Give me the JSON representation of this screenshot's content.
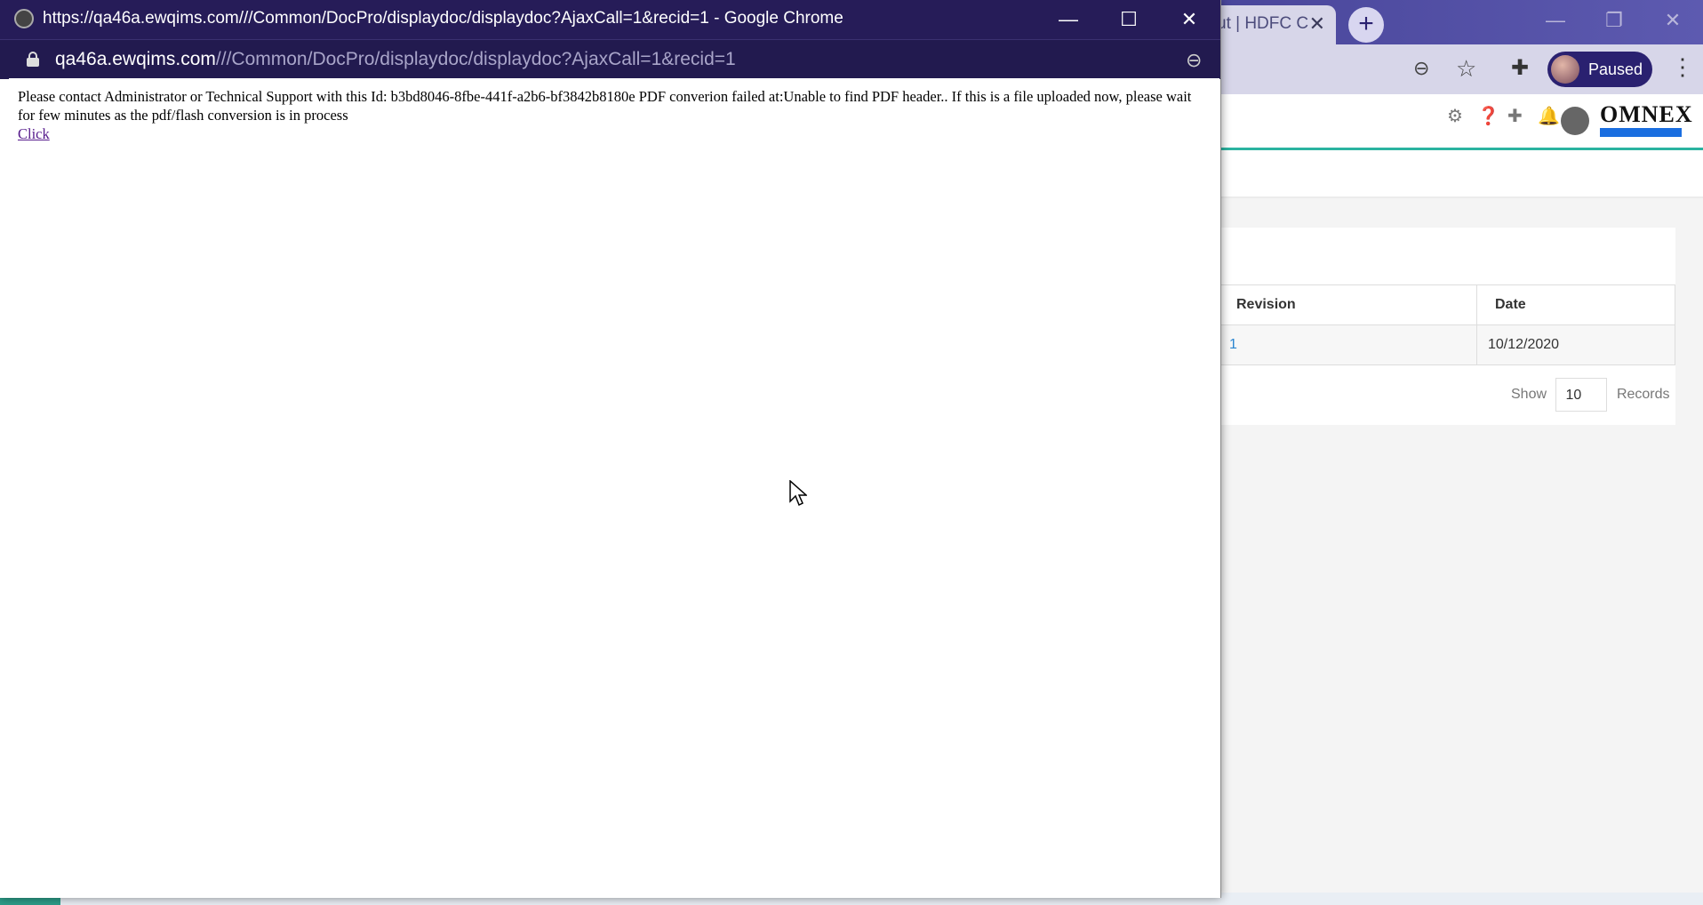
{
  "background_browser": {
    "tab": {
      "title": "ut | HDFC C",
      "close": "✕"
    },
    "new_tab": "+",
    "window_controls": {
      "minimize": "—",
      "restore": "❐",
      "close": "✕"
    },
    "toolbar": {
      "zoom_icon": "zoom-out-icon",
      "star_icon": "bookmark-star-icon",
      "extensions_icon": "puzzle-icon",
      "profile_label": "Paused",
      "menu_icon": "⋮"
    },
    "app_header": {
      "icons": [
        "gear-icon",
        "help-icon",
        "plus-icon",
        "bell-icon"
      ],
      "logo_text": "OMNEX"
    },
    "table": {
      "headers": [
        "Revision",
        "Date"
      ],
      "rows": [
        [
          "1",
          "10/12/2020"
        ]
      ]
    },
    "pager": {
      "show_label": "Show",
      "value": "10",
      "records_label": "Records"
    }
  },
  "popup": {
    "title": "https://qa46a.ewqims.com///Common/DocPro/displaydoc/displaydoc?AjaxCall=1&recid=1 - Google Chrome",
    "controls": {
      "minimize": "—",
      "maximize": "☐",
      "close": "✕"
    },
    "url_host": "qa46a.ewqims.com",
    "url_path": "///Common/DocPro/displaydoc/displaydoc?AjaxCall=1&recid=1",
    "message": "Please contact Administrator or Technical Support with this Id: b3bd8046-8fbe-441f-a2b6-bf3842b8180e PDF converion failed at:Unable to find PDF header.. If this is a file uploaded now, please wait for few minutes as the pdf/flash conversion is in process",
    "link": "Click"
  },
  "colors": {
    "popup_titlebar": "#261c58",
    "accent_teal": "#2bb3a0",
    "link_blue": "#2a85d0",
    "visited_link": "#551a8b"
  }
}
